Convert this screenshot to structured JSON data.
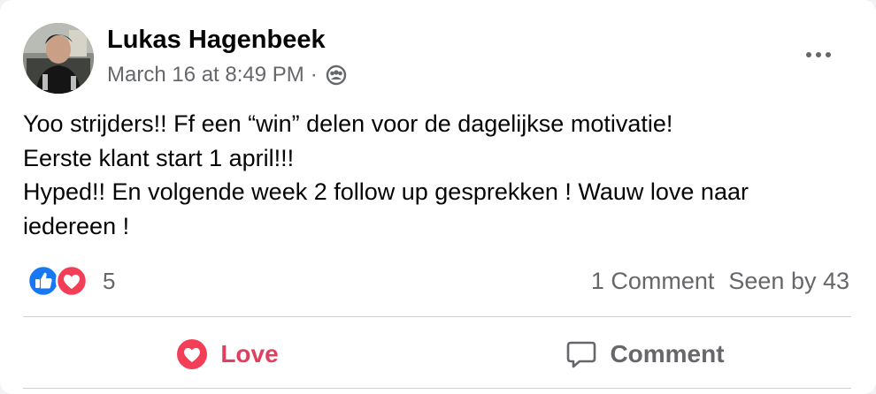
{
  "post": {
    "author_name": "Lukas Hagenbeek",
    "timestamp": "March 16 at 8:49 PM",
    "separator": "·",
    "audience_icon": "friends-icon",
    "more_icon": "ellipsis-icon",
    "body_lines": [
      "Yoo strijders!! Ff een “win” delen voor de dagelijkse motivatie!",
      "Eerste klant start 1 april!!!",
      "Hyped!! En volgende week 2 follow up gesprekken ! Wauw love naar",
      "iedereen !"
    ]
  },
  "reactions": {
    "types": [
      "like",
      "love"
    ],
    "count": "5",
    "like_color": "#1877f2",
    "love_color": "#f33e58"
  },
  "stats": {
    "comments": "1 Comment",
    "seen_by": "Seen by 43"
  },
  "actions": {
    "love_label": "Love",
    "love_color": "#e0405f",
    "comment_label": "Comment"
  }
}
